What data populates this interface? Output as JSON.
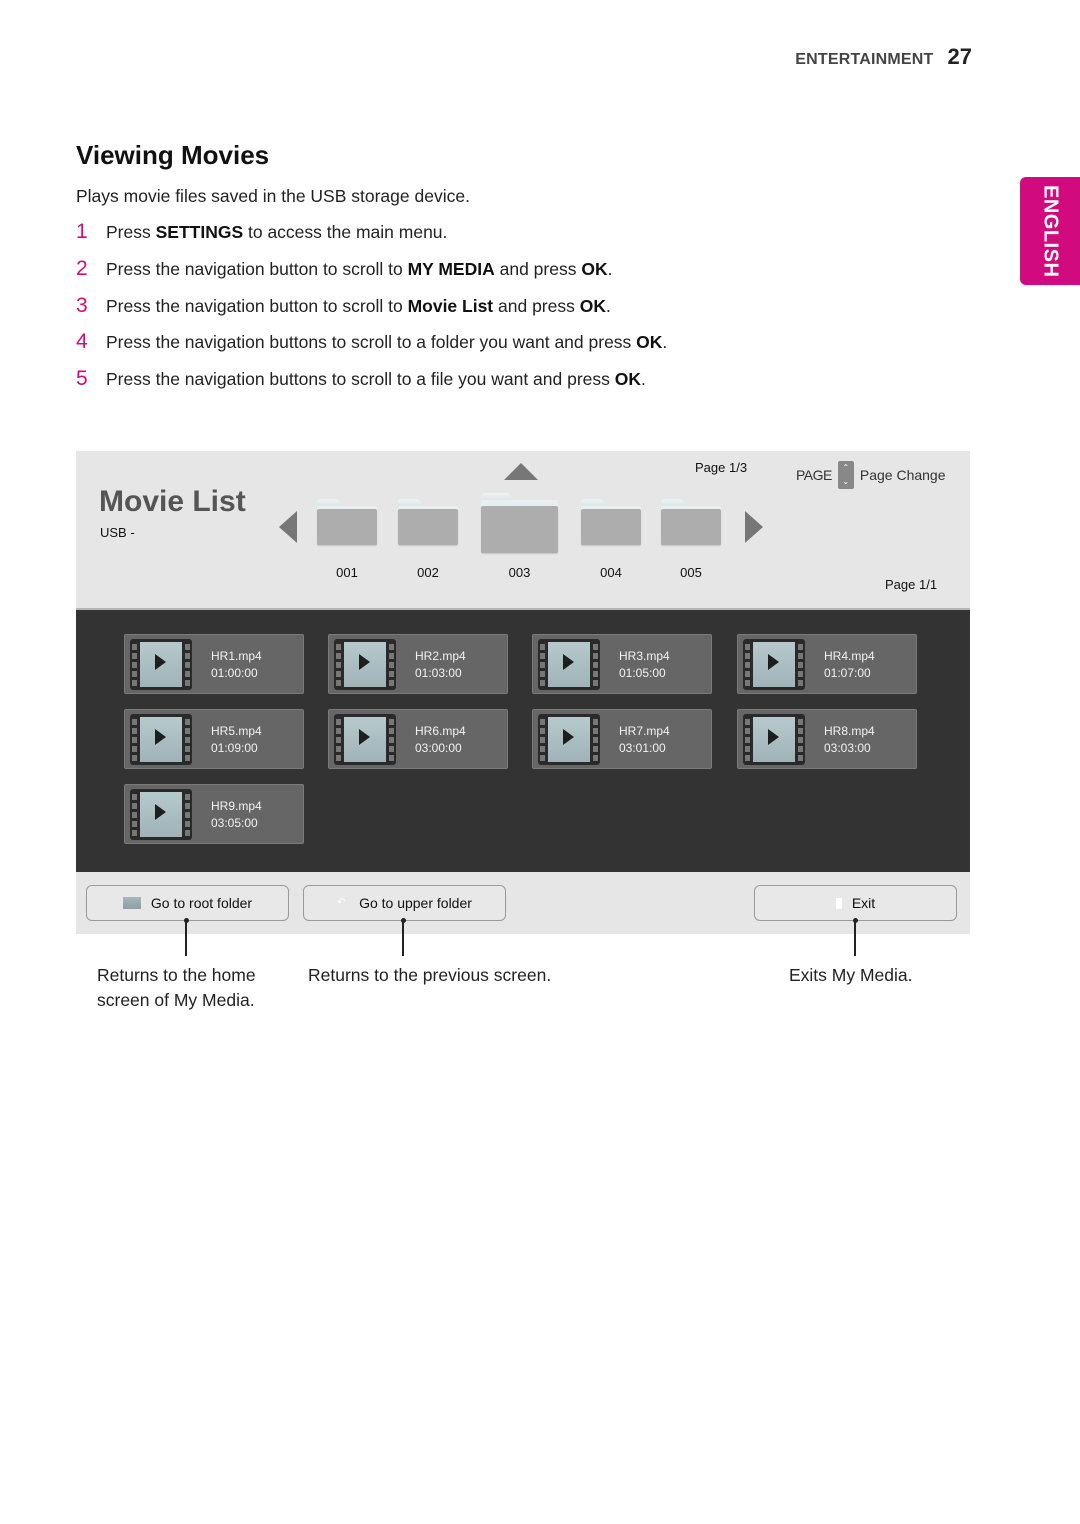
{
  "header": {
    "section": "ENTERTAINMENT",
    "page_number": "27"
  },
  "language_tab": "ENGLISH",
  "title": "Viewing Movies",
  "intro": "Plays movie files saved in the USB storage device.",
  "steps": [
    {
      "num": "1",
      "parts": [
        {
          "t": "Press "
        },
        {
          "b": "SETTINGS"
        },
        {
          "t": " to access the main menu."
        }
      ]
    },
    {
      "num": "2",
      "parts": [
        {
          "t": "Press the navigation button to scroll to "
        },
        {
          "b": "MY MEDIA"
        },
        {
          "t": " and press "
        },
        {
          "b": "OK"
        },
        {
          "t": "."
        }
      ]
    },
    {
      "num": "3",
      "parts": [
        {
          "t": "Press the navigation button to scroll to "
        },
        {
          "b": "Movie List"
        },
        {
          "t": " and press "
        },
        {
          "b": "OK"
        },
        {
          "t": "."
        }
      ]
    },
    {
      "num": "4",
      "parts": [
        {
          "t": "Press the navigation buttons to scroll to a folder you want and press "
        },
        {
          "b": "OK"
        },
        {
          "t": "."
        }
      ]
    },
    {
      "num": "5",
      "parts": [
        {
          "t": "Press the navigation buttons to scroll to a file you want and press "
        },
        {
          "b": "OK"
        },
        {
          "t": "."
        }
      ]
    }
  ],
  "screen": {
    "title": "Movie List",
    "source": "USB -",
    "folder_page": "Page 1/3",
    "page_key_label": "PAGE",
    "page_key_action": "Page Change",
    "file_page": "Page 1/1",
    "folders": [
      {
        "label": "001",
        "selected": false
      },
      {
        "label": "002",
        "selected": false
      },
      {
        "label": "003",
        "selected": true
      },
      {
        "label": "004",
        "selected": false
      },
      {
        "label": "005",
        "selected": false
      }
    ],
    "files": [
      {
        "name": "HR1.mp4",
        "duration": "01:00:00"
      },
      {
        "name": "HR2.mp4",
        "duration": "01:03:00"
      },
      {
        "name": "HR3.mp4",
        "duration": "01:05:00"
      },
      {
        "name": "HR4.mp4",
        "duration": "01:07:00"
      },
      {
        "name": "HR5.mp4",
        "duration": "01:09:00"
      },
      {
        "name": "HR6.mp4",
        "duration": "03:00:00"
      },
      {
        "name": "HR7.mp4",
        "duration": "03:01:00"
      },
      {
        "name": "HR8.mp4",
        "duration": "03:03:00"
      },
      {
        "name": "HR9.mp4",
        "duration": "03:05:00"
      }
    ],
    "buttons": {
      "root": "Go to root folder",
      "upper": "Go to upper folder",
      "exit": "Exit"
    }
  },
  "callouts": {
    "root": [
      "Returns to the home",
      "screen of My Media."
    ],
    "upper": "Returns to the previous screen.",
    "exit": "Exits My Media."
  },
  "colors": {
    "accent": "#d10a7d",
    "screen_bg": "#e6e6e6",
    "file_area_bg": "#333333",
    "file_card_bg": "#666666"
  }
}
